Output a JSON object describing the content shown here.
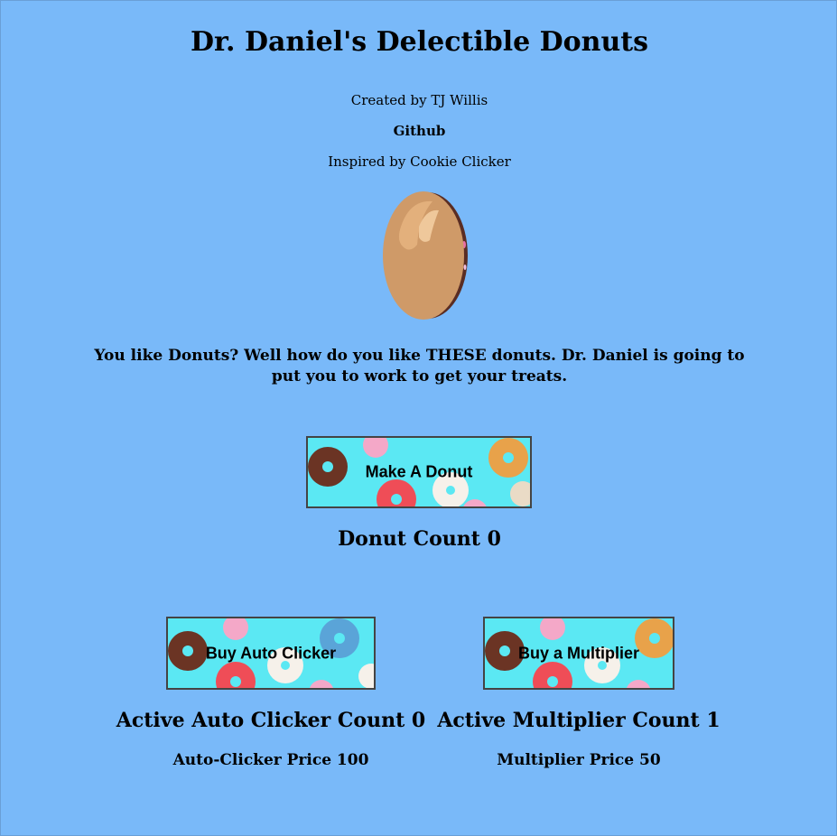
{
  "header": {
    "title": "Dr. Daniel's Delectible Donuts",
    "created_by": "Created by TJ Willis",
    "github_link": "Github",
    "inspired_by": "Inspired by Cookie Clicker"
  },
  "intro_text": "You like Donuts? Well how do you like THESE donuts. Dr. Daniel is going to put you to work to get your treats.",
  "make_button": {
    "label": "Make A Donut"
  },
  "donut_count": "Donut Count 0",
  "auto_clicker": {
    "button_label": "Buy Auto Clicker",
    "count": "Active Auto Clicker Count 0",
    "price": "Auto-Clicker Price 100"
  },
  "multiplier": {
    "button_label": "Buy a Multiplier",
    "count": "Active Multiplier Count 1",
    "price": "Multiplier Price 50"
  },
  "colors": {
    "background": "#79b9f9",
    "button_bg": "#5be8f3"
  },
  "icons": {
    "big_donut": "donut-icon",
    "button_pattern": "donut-pattern"
  }
}
